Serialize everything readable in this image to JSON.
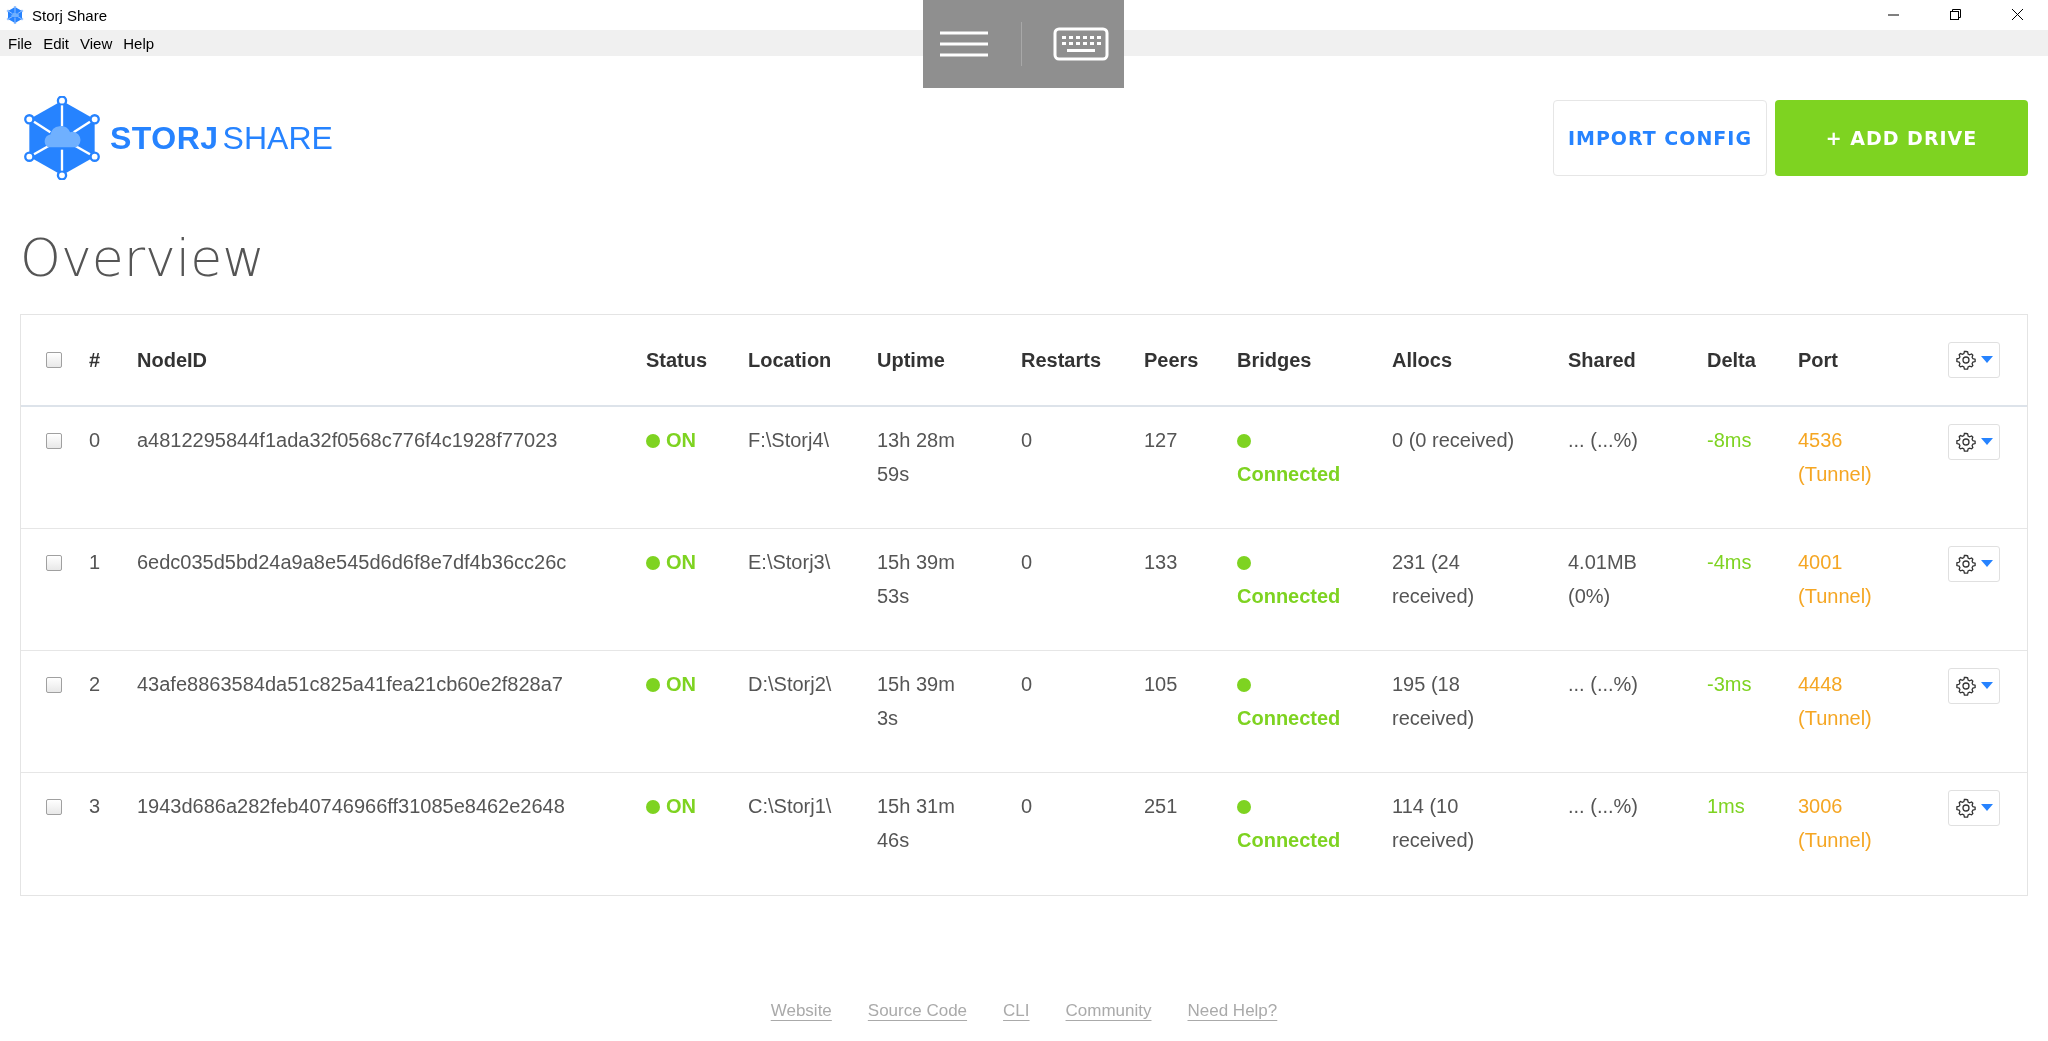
{
  "window": {
    "title": "Storj Share"
  },
  "menu": [
    "File",
    "Edit",
    "View",
    "Help"
  ],
  "logo": {
    "word_1": "STORJ",
    "word_2": "SHARE"
  },
  "buttons": {
    "import": "IMPORT CONFIG",
    "add": "+ ADD DRIVE"
  },
  "heading": "Overview",
  "table": {
    "select_all": {
      "checked": false
    },
    "columns": [
      "#",
      "NodeID",
      "Status",
      "Location",
      "Uptime",
      "Restarts",
      "Peers",
      "Bridges",
      "Allocs",
      "Shared",
      "Delta",
      "Port"
    ],
    "rows": [
      {
        "checked": false,
        "index": "0",
        "node_id": "a4812295844f1ada32f0568c776f4c1928f77023",
        "status": "ON",
        "location": "F:\\Storj4\\",
        "uptime": "13h 28m 59s",
        "restarts": "0",
        "peers": "127",
        "bridges": "Connected",
        "allocs": "0 (0 received)",
        "shared": "... (...%)",
        "delta": "-8ms",
        "port": "4536 (Tunnel)"
      },
      {
        "checked": false,
        "index": "1",
        "node_id": "6edc035d5bd24a9a8e545d6d6f8e7df4b36cc26c",
        "status": "ON",
        "location": "E:\\Storj3\\",
        "uptime": "15h 39m 53s",
        "restarts": "0",
        "peers": "133",
        "bridges": "Connected",
        "allocs": "231 (24 received)",
        "shared": "4.01MB (0%)",
        "delta": "-4ms",
        "port": "4001 (Tunnel)"
      },
      {
        "checked": false,
        "index": "2",
        "node_id": "43afe8863584da51c825a41fea21cb60e2f828a7",
        "status": "ON",
        "location": "D:\\Storj2\\",
        "uptime": "15h 39m 3s",
        "restarts": "0",
        "peers": "105",
        "bridges": "Connected",
        "allocs": "195 (18 received)",
        "shared": "... (...%)",
        "delta": "-3ms",
        "port": "4448 (Tunnel)"
      },
      {
        "checked": false,
        "index": "3",
        "node_id": "1943d686a282feb40746966ff31085e8462e2648",
        "status": "ON",
        "location": "C:\\Storj1\\",
        "uptime": "15h 31m 46s",
        "restarts": "0",
        "peers": "251",
        "bridges": "Connected",
        "allocs": "114 (10 received)",
        "shared": "... (...%)",
        "delta": "1ms",
        "port": "3006 (Tunnel)"
      }
    ]
  },
  "footer_links": [
    "Website",
    "Source Code",
    "CLI",
    "Community",
    "Need Help?"
  ]
}
